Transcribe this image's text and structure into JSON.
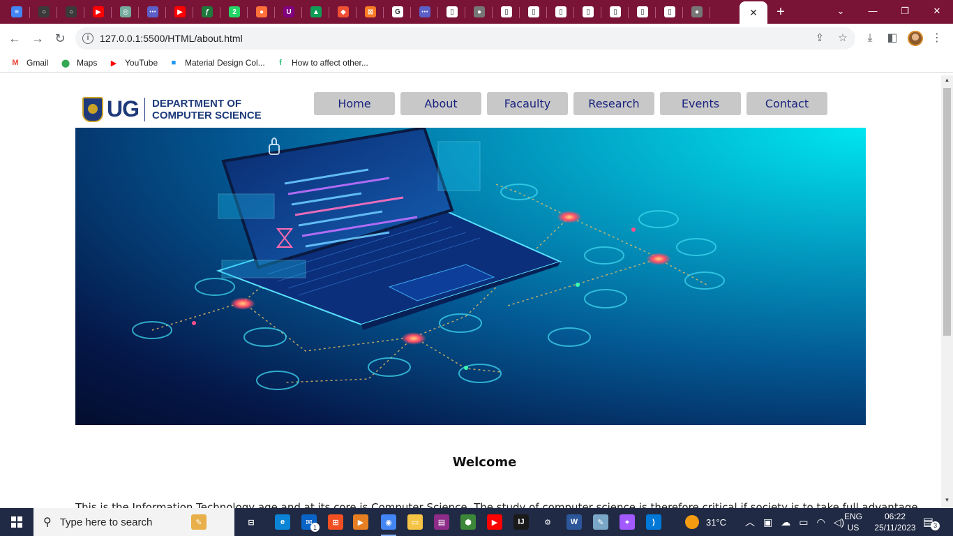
{
  "browser": {
    "tabs": [
      {
        "icon": "docs-icon",
        "color": "#4285f4",
        "glyph": "≡"
      },
      {
        "icon": "github-icon",
        "color": "#3a3a3a",
        "glyph": "○"
      },
      {
        "icon": "github-icon",
        "color": "#3a3a3a",
        "glyph": "○"
      },
      {
        "icon": "youtube-icon",
        "color": "#ff0000",
        "glyph": "▶"
      },
      {
        "icon": "chatgpt-icon",
        "color": "#74aa9c",
        "glyph": "◎"
      },
      {
        "icon": "link-icon",
        "color": "#5b5fc7",
        "glyph": "⋯"
      },
      {
        "icon": "youtube-icon",
        "color": "#ff0000",
        "glyph": "▶"
      },
      {
        "icon": "app-icon",
        "color": "#1e7a3c",
        "glyph": "ƒ"
      },
      {
        "icon": "whatsapp-icon",
        "color": "#25d366",
        "glyph": "2"
      },
      {
        "icon": "firefox-icon",
        "color": "#ff7139",
        "glyph": "●"
      },
      {
        "icon": "ublock-icon",
        "color": "#800080",
        "glyph": "U"
      },
      {
        "icon": "drive-icon",
        "color": "#0f9d58",
        "glyph": "▲"
      },
      {
        "icon": "git-icon",
        "color": "#f05033",
        "glyph": "◆"
      },
      {
        "icon": "xampp-icon",
        "color": "#fb7a24",
        "glyph": "⊠"
      },
      {
        "icon": "google-icon",
        "color": "#ffffff",
        "glyph": "G"
      },
      {
        "icon": "link-icon",
        "color": "#5b5fc7",
        "glyph": "⋯"
      },
      {
        "icon": "page-icon",
        "color": "#ffffff",
        "glyph": "▯"
      },
      {
        "icon": "globe-icon",
        "color": "#777777",
        "glyph": "●"
      },
      {
        "icon": "page-icon",
        "color": "#ffffff",
        "glyph": "▯"
      },
      {
        "icon": "page-icon",
        "color": "#ffffff",
        "glyph": "▯"
      },
      {
        "icon": "page-icon",
        "color": "#ffffff",
        "glyph": "▯"
      },
      {
        "icon": "page-icon",
        "color": "#ffffff",
        "glyph": "▯"
      },
      {
        "icon": "page-icon",
        "color": "#ffffff",
        "glyph": "▯"
      },
      {
        "icon": "page-icon",
        "color": "#ffffff",
        "glyph": "▯"
      },
      {
        "icon": "page-icon",
        "color": "#ffffff",
        "glyph": "▯"
      },
      {
        "icon": "globe-icon",
        "color": "#777777",
        "glyph": "●"
      }
    ],
    "active_tab_close": "✕",
    "new_tab": "+",
    "address": {
      "url": "127.0.0.1:5500/HTML/about.html",
      "info": "i"
    },
    "bookmarks": [
      {
        "label": "Gmail",
        "icon": "gmail-icon",
        "glyph": "M",
        "color": "#ea4335"
      },
      {
        "label": "Maps",
        "icon": "maps-icon",
        "glyph": "⬤",
        "color": "#34a853"
      },
      {
        "label": "YouTube",
        "icon": "youtube-icon",
        "glyph": "▶",
        "color": "#ff0000"
      },
      {
        "label": "Material Design Col...",
        "icon": "material-icon",
        "glyph": "■",
        "color": "#2196f3"
      },
      {
        "label": "How to affect other...",
        "icon": "fiverr-icon",
        "glyph": "f",
        "color": "#1dbf73"
      }
    ]
  },
  "site": {
    "logo": {
      "mark": "UG",
      "line1": "DEPARTMENT OF",
      "line2": "COMPUTER SCIENCE"
    },
    "nav": [
      "Home",
      "About",
      "Facaulty",
      "Research",
      "Events",
      "Contact"
    ],
    "welcome": "Welcome",
    "intro": "This is the Information Technology age and at its core is Computer Science. The study of computer science is therefore critical if society is to take full advantage"
  },
  "taskbar": {
    "search_placeholder": "Type here to search",
    "apps": [
      {
        "icon": "notes-icon",
        "color": "#e8b04a",
        "glyph": "✎"
      },
      {
        "icon": "task-view-icon",
        "color": "#202a44",
        "glyph": "⊟"
      },
      {
        "icon": "edge-icon",
        "color": "#0c84d6",
        "glyph": "e"
      },
      {
        "icon": "mail-icon",
        "color": "#0a64c8",
        "glyph": "✉",
        "badge": "1"
      },
      {
        "icon": "store-icon",
        "color": "#f25022",
        "glyph": "⊞"
      },
      {
        "icon": "media-icon",
        "color": "#e67e22",
        "glyph": "▶"
      },
      {
        "icon": "chrome-icon",
        "color": "#4285f4",
        "glyph": "◉"
      },
      {
        "icon": "files-icon",
        "color": "#f6c445",
        "glyph": "▭"
      },
      {
        "icon": "winrar-icon",
        "color": "#8e2c8a",
        "glyph": "▤"
      },
      {
        "icon": "node-icon",
        "color": "#3c873a",
        "glyph": "⬢"
      },
      {
        "icon": "youtube-app-icon",
        "color": "#ff0000",
        "glyph": "▶"
      },
      {
        "icon": "intellij-icon",
        "color": "#1a1a1a",
        "glyph": "IJ"
      },
      {
        "icon": "settings-icon",
        "color": "#202a44",
        "glyph": "⚙"
      },
      {
        "icon": "word-icon",
        "color": "#2b579a",
        "glyph": "W"
      },
      {
        "icon": "pen-icon",
        "color": "#7aa7c7",
        "glyph": "✎"
      },
      {
        "icon": "figma-icon",
        "color": "#a259ff",
        "glyph": "✦"
      },
      {
        "icon": "vscode-icon",
        "color": "#0078d7",
        "glyph": "⟩"
      }
    ],
    "weather": "31°C",
    "lang": "ENG",
    "region": "US",
    "time": "06:22",
    "date": "25/11/2023",
    "notifications": "3"
  }
}
